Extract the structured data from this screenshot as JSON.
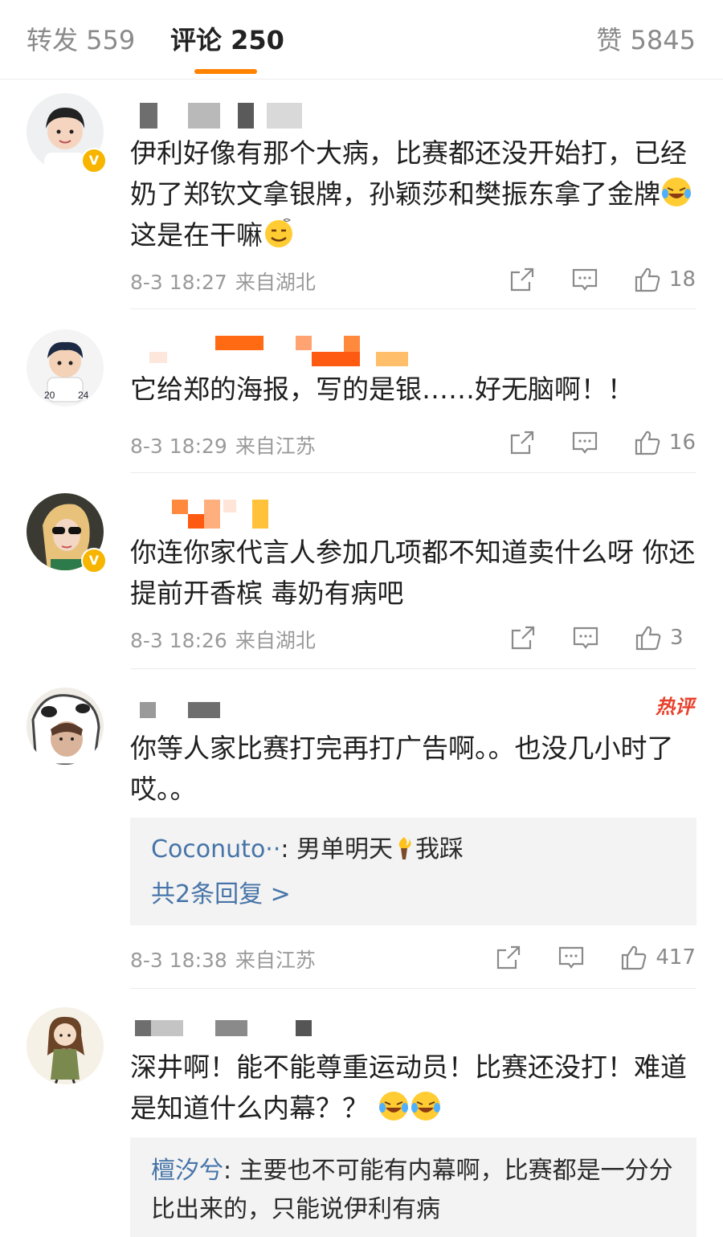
{
  "tabs": {
    "repost": "转发 559",
    "comments": "评论 250",
    "likes": "赞 5845"
  },
  "comments": [
    {
      "text_1": "伊利好像有那个大病，比赛都还没开始打，已经奶了郑钦文拿银牌，孙颖莎和樊振东拿了金牌",
      "text_2": "这是在干嘛",
      "time": "8-3 18:27",
      "region": "来自湖北",
      "likes": "18"
    },
    {
      "text": "它给郑的海报，写的是银……好无脑啊！！",
      "time": "8-3 18:29",
      "region": "来自江苏",
      "likes": "16"
    },
    {
      "text": "你连你家代言人参加几项都不知道卖什么呀 你还提前开香槟 毒奶有病吧",
      "time": "8-3 18:26",
      "region": "来自湖北",
      "likes": "3"
    },
    {
      "badge": "热评",
      "text": "你等人家比赛打完再打广告啊。。也没几小时了哎。。",
      "reply_user": "Coconuto··",
      "reply_text_1": "男单明天",
      "reply_text_2": "我踩",
      "reply_more": "共2条回复 >",
      "time": "8-3 18:38",
      "region": "来自江苏",
      "likes": "417"
    },
    {
      "text": "深井啊！能不能尊重运动员！比赛还没打！难道是知道什么内幕？？",
      "reply_user": "檀汐兮",
      "reply_text": "主要也不可能有内幕啊，比赛都是一分分比出来的，只能说伊利有病"
    }
  ]
}
